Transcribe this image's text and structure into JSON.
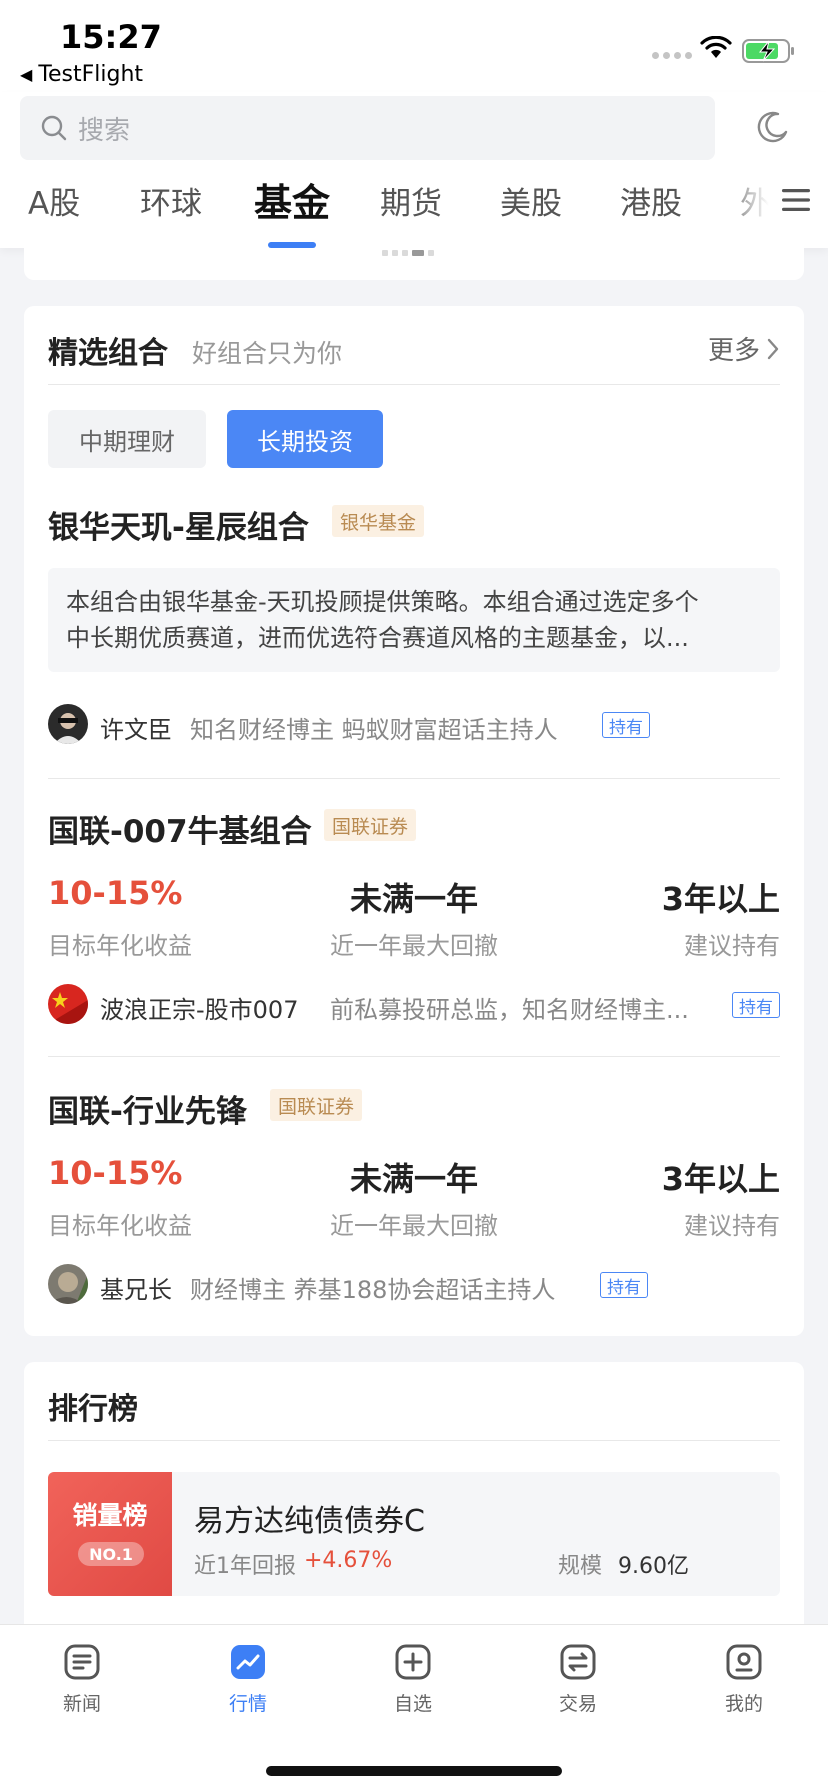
{
  "status_bar": {
    "time": "15:27",
    "back_app": "TestFlight"
  },
  "search": {
    "placeholder": "搜索"
  },
  "tabs": [
    {
      "label": "A股",
      "active": false
    },
    {
      "label": "环球",
      "active": false
    },
    {
      "label": "基金",
      "active": true
    },
    {
      "label": "期货",
      "active": false
    },
    {
      "label": "美股",
      "active": false
    },
    {
      "label": "港股",
      "active": false
    },
    {
      "label": "外",
      "active": false
    }
  ],
  "portfolio": {
    "title": "精选组合",
    "subtitle": "好组合只为你",
    "more": "更多",
    "chips": [
      "中期理财",
      "长期投资"
    ],
    "active_chip": "长期投资",
    "items": [
      {
        "name": "银华天玑-星辰组合",
        "badge": "银华基金",
        "desc_line1": "本组合由银华基金-天玑投顾提供策略。本组合通过选定多个",
        "desc_line2": "中长期优质赛道，进而优选符合赛道风格的主题基金，以...",
        "person": "许文臣",
        "person_desc": "知名财经博主 蚂蚁财富超话主持人",
        "tag": "持有"
      },
      {
        "name": "国联-007牛基组合",
        "badge": "国联证券",
        "return_value": "10-15%",
        "return_label": "目标年化收益",
        "drawdown_value": "未满一年",
        "drawdown_label": "近一年最大回撤",
        "hold_value": "3年以上",
        "hold_label": "建议持有",
        "person": "波浪正宗-股市007",
        "person_desc": "前私募投研总监，知名财经博主...",
        "tag": "持有"
      },
      {
        "name": "国联-行业先锋",
        "badge": "国联证券",
        "return_value": "10-15%",
        "return_label": "目标年化收益",
        "drawdown_value": "未满一年",
        "drawdown_label": "近一年最大回撤",
        "hold_value": "3年以上",
        "hold_label": "建议持有",
        "person": "基兄长",
        "person_desc": "财经博主  养基188协会超话主持人",
        "tag": "持有"
      }
    ]
  },
  "ranking": {
    "title": "排行榜",
    "tag_title": "销量榜",
    "tag_no": "NO.1",
    "fund_name": "易方达纯债债券C",
    "return_label": "近1年回报",
    "return_value": "+4.67%",
    "scale_label": "规模",
    "scale_value": "9.60亿"
  },
  "bottom_nav": [
    {
      "label": "新闻",
      "icon": "news-icon",
      "active": false
    },
    {
      "label": "行情",
      "icon": "market-icon",
      "active": true
    },
    {
      "label": "自选",
      "icon": "add-watchlist-icon",
      "active": false
    },
    {
      "label": "交易",
      "icon": "trade-icon",
      "active": false
    },
    {
      "label": "我的",
      "icon": "profile-icon",
      "active": false
    }
  ],
  "colors": {
    "accent": "#3d7ff5",
    "up_red": "#e5503b",
    "badge_bg": "#fbf0e2",
    "badge_text": "#b98b52"
  }
}
